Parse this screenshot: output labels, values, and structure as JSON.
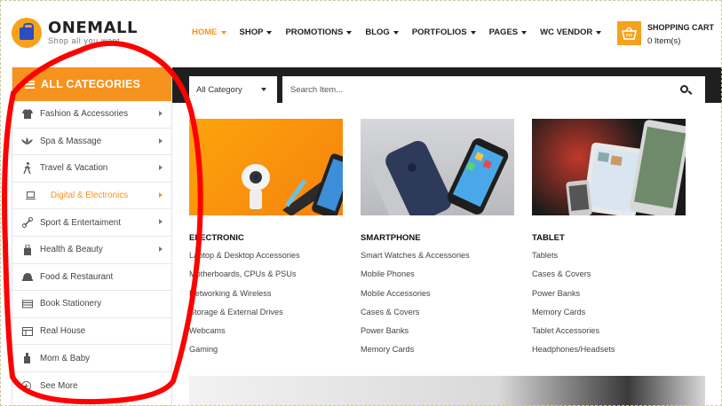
{
  "brand": {
    "name": "ONEMALL",
    "tagline": "Shop all you want"
  },
  "nav": {
    "items": [
      {
        "label": "HOME",
        "active": true
      },
      {
        "label": "SHOP"
      },
      {
        "label": "PROMOTIONS"
      },
      {
        "label": "BLOG"
      },
      {
        "label": "PORTFOLIOS"
      },
      {
        "label": "PAGES"
      },
      {
        "label": "WC VENDOR"
      }
    ]
  },
  "cart": {
    "title": "SHOPPING CART",
    "count": "0 Item(s)"
  },
  "sidebar": {
    "header": "ALL CATEGORIES",
    "items": [
      {
        "label": "Fashion & Accessories",
        "icon": "shirt-icon"
      },
      {
        "label": "Spa & Massage",
        "icon": "lotus-icon"
      },
      {
        "label": "Travel & Vacation",
        "icon": "walking-person-icon"
      },
      {
        "label": "Digital & Electronics",
        "icon": "laptop-icon",
        "active": true
      },
      {
        "label": "Sport & Entertaiment",
        "icon": "dumbbell-icon"
      },
      {
        "label": "Health & Beauty",
        "icon": "bottle-icon"
      },
      {
        "label": "Food & Restaurant",
        "icon": "cap-icon"
      },
      {
        "label": "Book Stationery",
        "icon": "book-icon"
      },
      {
        "label": "Real House",
        "icon": "house-icon"
      },
      {
        "label": "Mom & Baby",
        "icon": "baby-bottle-icon"
      }
    ],
    "see_more": "See More"
  },
  "search": {
    "category_selected": "All Category",
    "placeholder": "Search Item..."
  },
  "mega_menu": {
    "columns": [
      {
        "title": "ELECTRONIC",
        "links": [
          "Laptop & Desktop Accessories",
          "Motherboards, CPUs & PSUs",
          "Networking & Wireless",
          "Storage & External Drives",
          "Webcams",
          "Gaming"
        ]
      },
      {
        "title": "SMARTPHONE",
        "links": [
          "Smart Watches & Accessories",
          "Mobile Phones",
          "Mobile Accessories",
          "Cases & Covers",
          "Power Banks",
          "Memory Cards"
        ]
      },
      {
        "title": "TABLET",
        "links": [
          "Tablets",
          "Cases & Covers",
          "Power Banks",
          "Memory Cards",
          "Tablet Accessories",
          "Headphones/Headsets"
        ]
      }
    ]
  },
  "colors": {
    "accent": "#f6921e",
    "dark_bar": "#1f1f1f",
    "annotation": "#ff0000"
  }
}
